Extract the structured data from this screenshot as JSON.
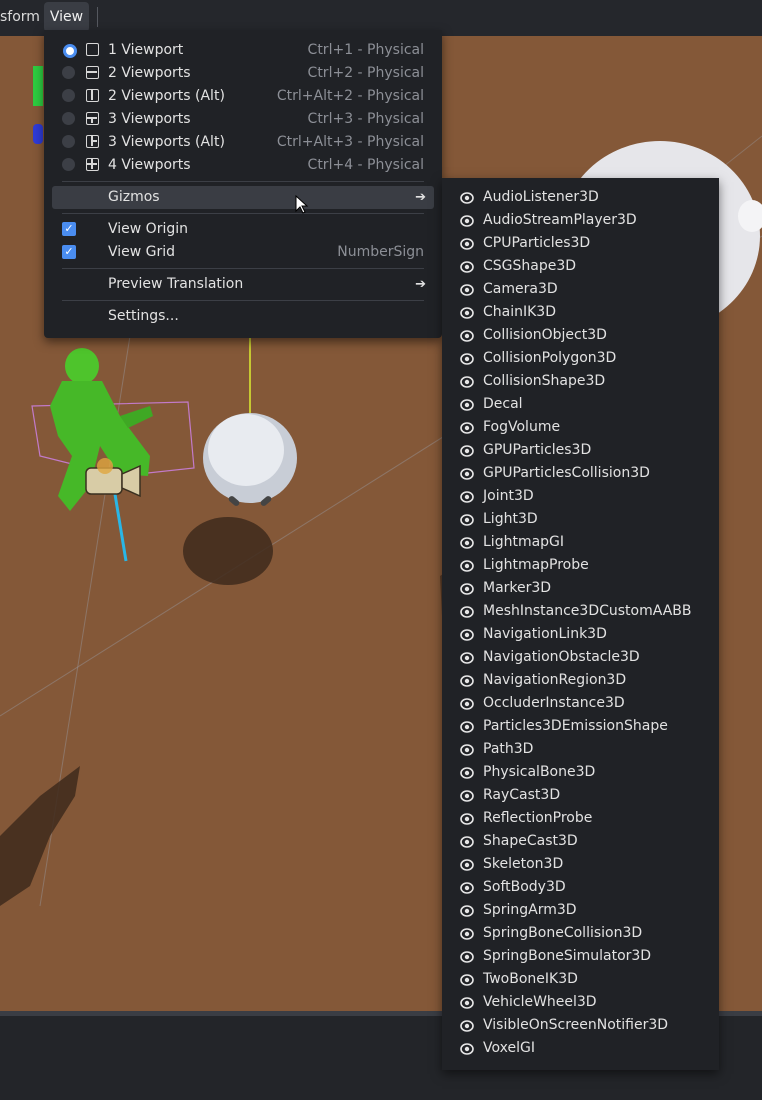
{
  "toolbar": {
    "transform_label": "sform",
    "view_label": "View"
  },
  "view_menu": {
    "viewports": [
      {
        "label": "1 Viewport",
        "shortcut": "Ctrl+1 - Physical",
        "selected": true,
        "icon": "layout-1-icon"
      },
      {
        "label": "2 Viewports",
        "shortcut": "Ctrl+2 - Physical",
        "selected": false,
        "icon": "layout-2-horizontal-icon"
      },
      {
        "label": "2 Viewports (Alt)",
        "shortcut": "Ctrl+Alt+2 - Physical",
        "selected": false,
        "icon": "layout-2-vertical-icon"
      },
      {
        "label": "3 Viewports",
        "shortcut": "Ctrl+3 - Physical",
        "selected": false,
        "icon": "layout-3-icon"
      },
      {
        "label": "3 Viewports (Alt)",
        "shortcut": "Ctrl+Alt+3 - Physical",
        "selected": false,
        "icon": "layout-3-alt-icon"
      },
      {
        "label": "4 Viewports",
        "shortcut": "Ctrl+4 - Physical",
        "selected": false,
        "icon": "layout-4-icon"
      }
    ],
    "gizmos_label": "Gizmos",
    "view_origin": {
      "label": "View Origin",
      "checked": true
    },
    "view_grid": {
      "label": "View Grid",
      "checked": true,
      "shortcut": "NumberSign"
    },
    "preview_translation_label": "Preview Translation",
    "settings_label": "Settings..."
  },
  "gizmos_menu": {
    "items": [
      "AudioListener3D",
      "AudioStreamPlayer3D",
      "CPUParticles3D",
      "CSGShape3D",
      "Camera3D",
      "ChainIK3D",
      "CollisionObject3D",
      "CollisionPolygon3D",
      "CollisionShape3D",
      "Decal",
      "FogVolume",
      "GPUParticles3D",
      "GPUParticlesCollision3D",
      "Joint3D",
      "Light3D",
      "LightmapGI",
      "LightmapProbe",
      "Marker3D",
      "MeshInstance3DCustomAABB",
      "NavigationLink3D",
      "NavigationObstacle3D",
      "NavigationRegion3D",
      "OccluderInstance3D",
      "Particles3DEmissionShape",
      "Path3D",
      "PhysicalBone3D",
      "RayCast3D",
      "ReflectionProbe",
      "ShapeCast3D",
      "Skeleton3D",
      "SoftBody3D",
      "SpringArm3D",
      "SpringBoneCollision3D",
      "SpringBoneSimulator3D",
      "TwoBoneIK3D",
      "VehicleWheel3D",
      "VisibleOnScreenNotifier3D",
      "VoxelGI"
    ]
  },
  "colors": {
    "accent": "#4a8df0",
    "menu_bg": "#202226",
    "viewport_ground": "#845838"
  }
}
